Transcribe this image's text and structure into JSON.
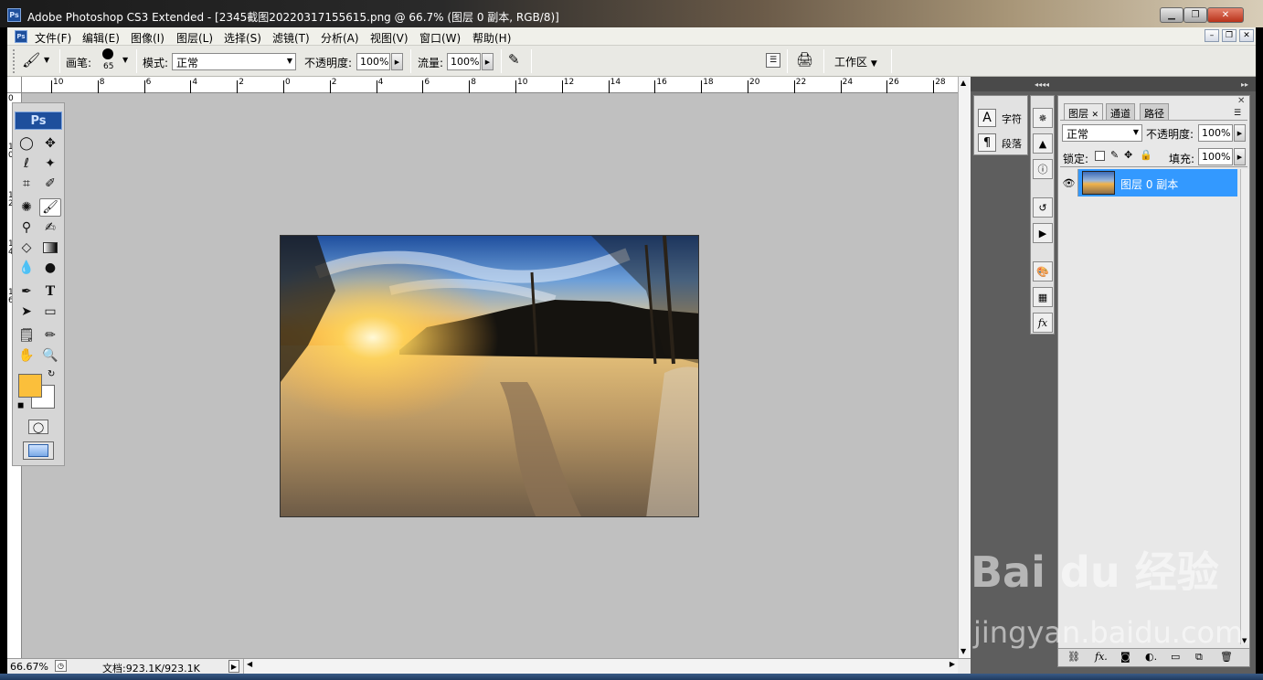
{
  "window": {
    "title": "Adobe Photoshop CS3 Extended - [2345截图20220317155615.png @ 66.7% (图层 0 副本, RGB/8)]",
    "app_badge": "Ps"
  },
  "menu": [
    "文件(F)",
    "编辑(E)",
    "图像(I)",
    "图层(L)",
    "选择(S)",
    "滤镜(T)",
    "分析(A)",
    "视图(V)",
    "窗口(W)",
    "帮助(H)"
  ],
  "options": {
    "brush_label": "画笔:",
    "brush_size": "65",
    "mode_label": "模式:",
    "mode_value": "正常",
    "opacity_label": "不透明度:",
    "opacity_value": "100%",
    "flow_label": "流量:",
    "flow_value": "100%",
    "workspace_label": "工作区"
  },
  "ruler_top": [
    "10",
    "8",
    "6",
    "4",
    "2",
    "0",
    "2",
    "4",
    "6",
    "8",
    "10",
    "12",
    "14",
    "16",
    "18",
    "20",
    "22",
    "24",
    "26",
    "28"
  ],
  "ruler_left": [
    "0",
    "1 0",
    "1 2",
    "1 4",
    "1 6"
  ],
  "toolbox": {
    "badge": "Ps"
  },
  "colors": {
    "foreground": "#fbbf3b",
    "background": "#ffffff",
    "selection": "#3399ff"
  },
  "char_panel": {
    "char_label": "字符",
    "para_label": "段落"
  },
  "layers_panel": {
    "tabs": [
      "图层",
      "通道",
      "路径"
    ],
    "blend_mode": "正常",
    "opacity_label": "不透明度:",
    "opacity_value": "100%",
    "lock_label": "锁定:",
    "fill_label": "填充:",
    "fill_value": "100%",
    "layer_name": "图层 0 副本"
  },
  "status": {
    "zoom": "66.67%",
    "doc": "文档:923.1K/923.1K"
  },
  "watermark": {
    "main": "Bai du 经验",
    "sub": "jingyan.baidu.com"
  }
}
